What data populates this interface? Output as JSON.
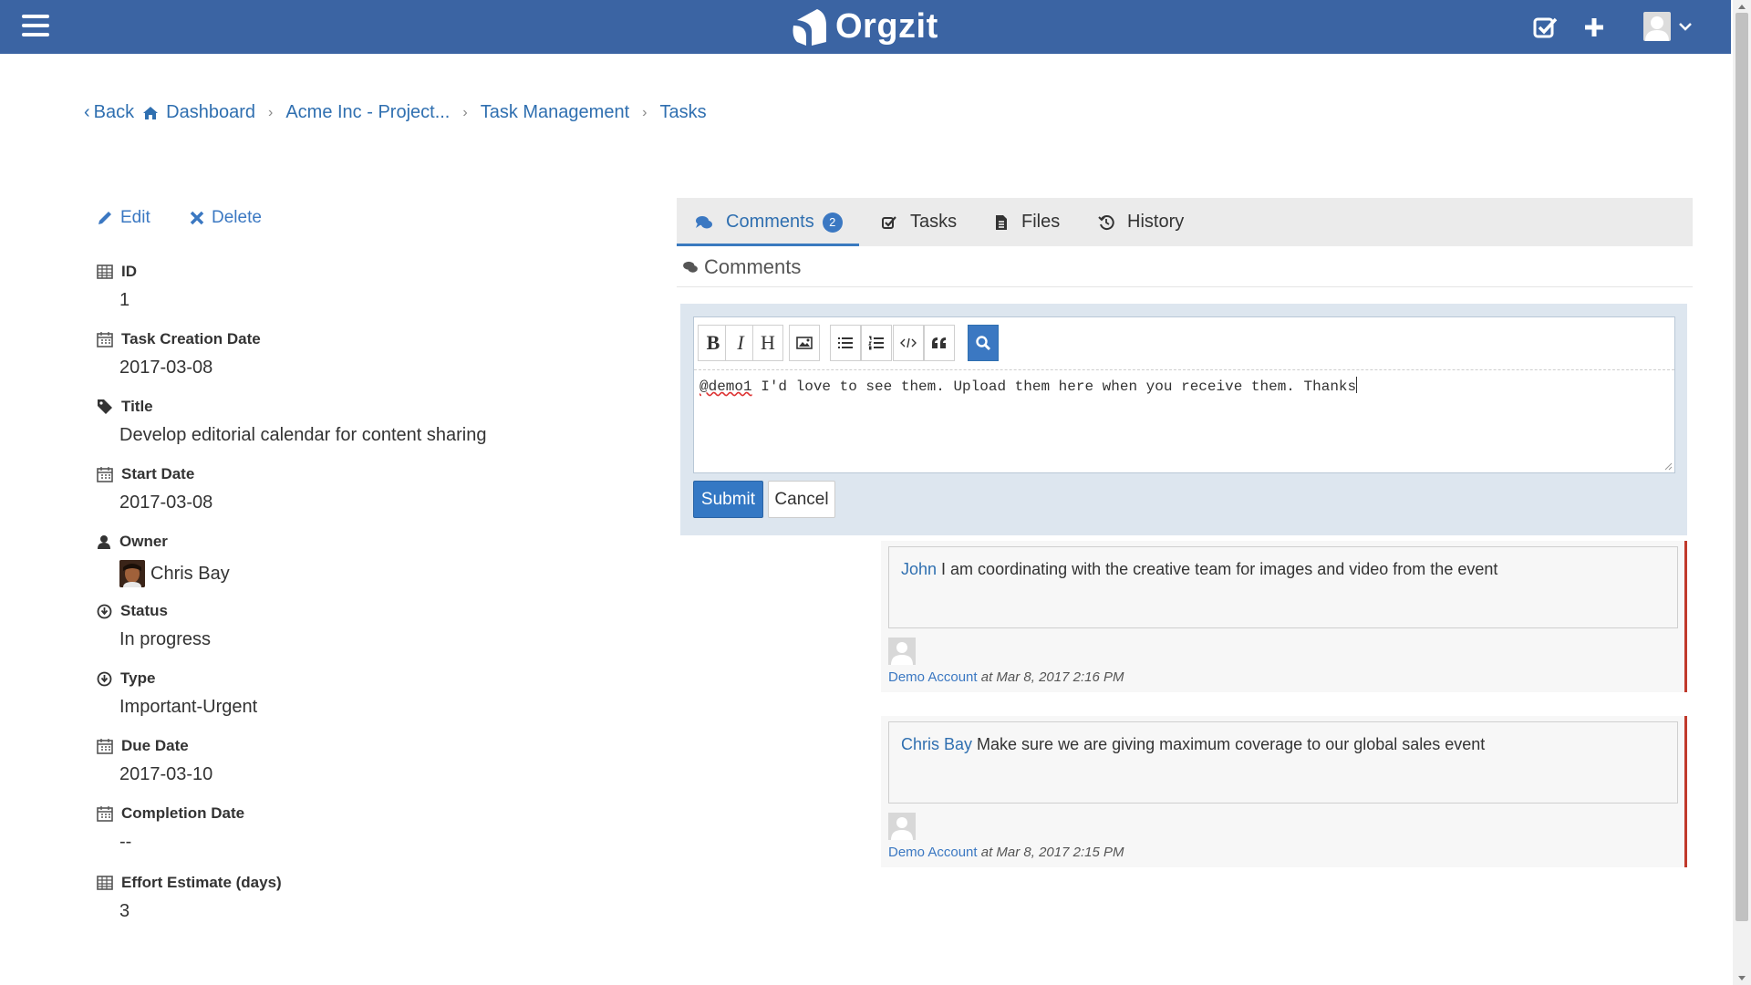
{
  "app": {
    "brand": "Orgzit"
  },
  "breadcrumb": {
    "back": "Back",
    "items": [
      "Dashboard",
      "Acme Inc - Project...",
      "Task Management",
      "Tasks"
    ]
  },
  "actions": {
    "edit": "Edit",
    "delete": "Delete"
  },
  "fields": [
    {
      "label": "ID",
      "value": "1",
      "icon": "table-icon"
    },
    {
      "label": "Task Creation Date",
      "value": "2017-03-08",
      "icon": "calendar-icon"
    },
    {
      "label": "Title",
      "value": "Develop editorial calendar for content sharing",
      "icon": "tag-icon"
    },
    {
      "label": "Start Date",
      "value": "2017-03-08",
      "icon": "calendar-icon"
    },
    {
      "label": "Owner",
      "value": "Chris Bay",
      "icon": "user-icon"
    },
    {
      "label": "Status",
      "value": "In progress",
      "icon": "circle-arrow-icon"
    },
    {
      "label": "Type",
      "value": "Important-Urgent",
      "icon": "circle-arrow-icon"
    },
    {
      "label": "Due Date",
      "value": "2017-03-10",
      "icon": "calendar-icon"
    },
    {
      "label": "Completion Date",
      "value": "--",
      "icon": "calendar-icon"
    },
    {
      "label": "Effort Estimate (days)",
      "value": "3",
      "icon": "table-icon"
    }
  ],
  "tabs": {
    "comments": "Comments",
    "comments_count": "2",
    "tasks": "Tasks",
    "files": "Files",
    "history": "History"
  },
  "section_title": "Comments",
  "editor": {
    "toolbar": {
      "bold": "B",
      "italic": "I",
      "heading": "H"
    },
    "mention": "@demo1",
    "text": " I'd love to see them. Upload them here when you receive them. Thanks",
    "submit": "Submit",
    "cancel": "Cancel"
  },
  "comments": [
    {
      "author": "John",
      "text": " I am coordinating with the creative team for images and video from the event",
      "poster": "Demo Account",
      "time": " at Mar 8, 2017 2:16 PM"
    },
    {
      "author": "Chris Bay",
      "text": " Make sure we are giving maximum coverage to our global sales event",
      "poster": "Demo Account",
      "time": " at Mar 8, 2017 2:15 PM"
    }
  ],
  "colors": {
    "navbar": "#3b64a3",
    "link": "#2f6fb0",
    "accent": "#3478c4",
    "comment_border": "#c0392b"
  }
}
